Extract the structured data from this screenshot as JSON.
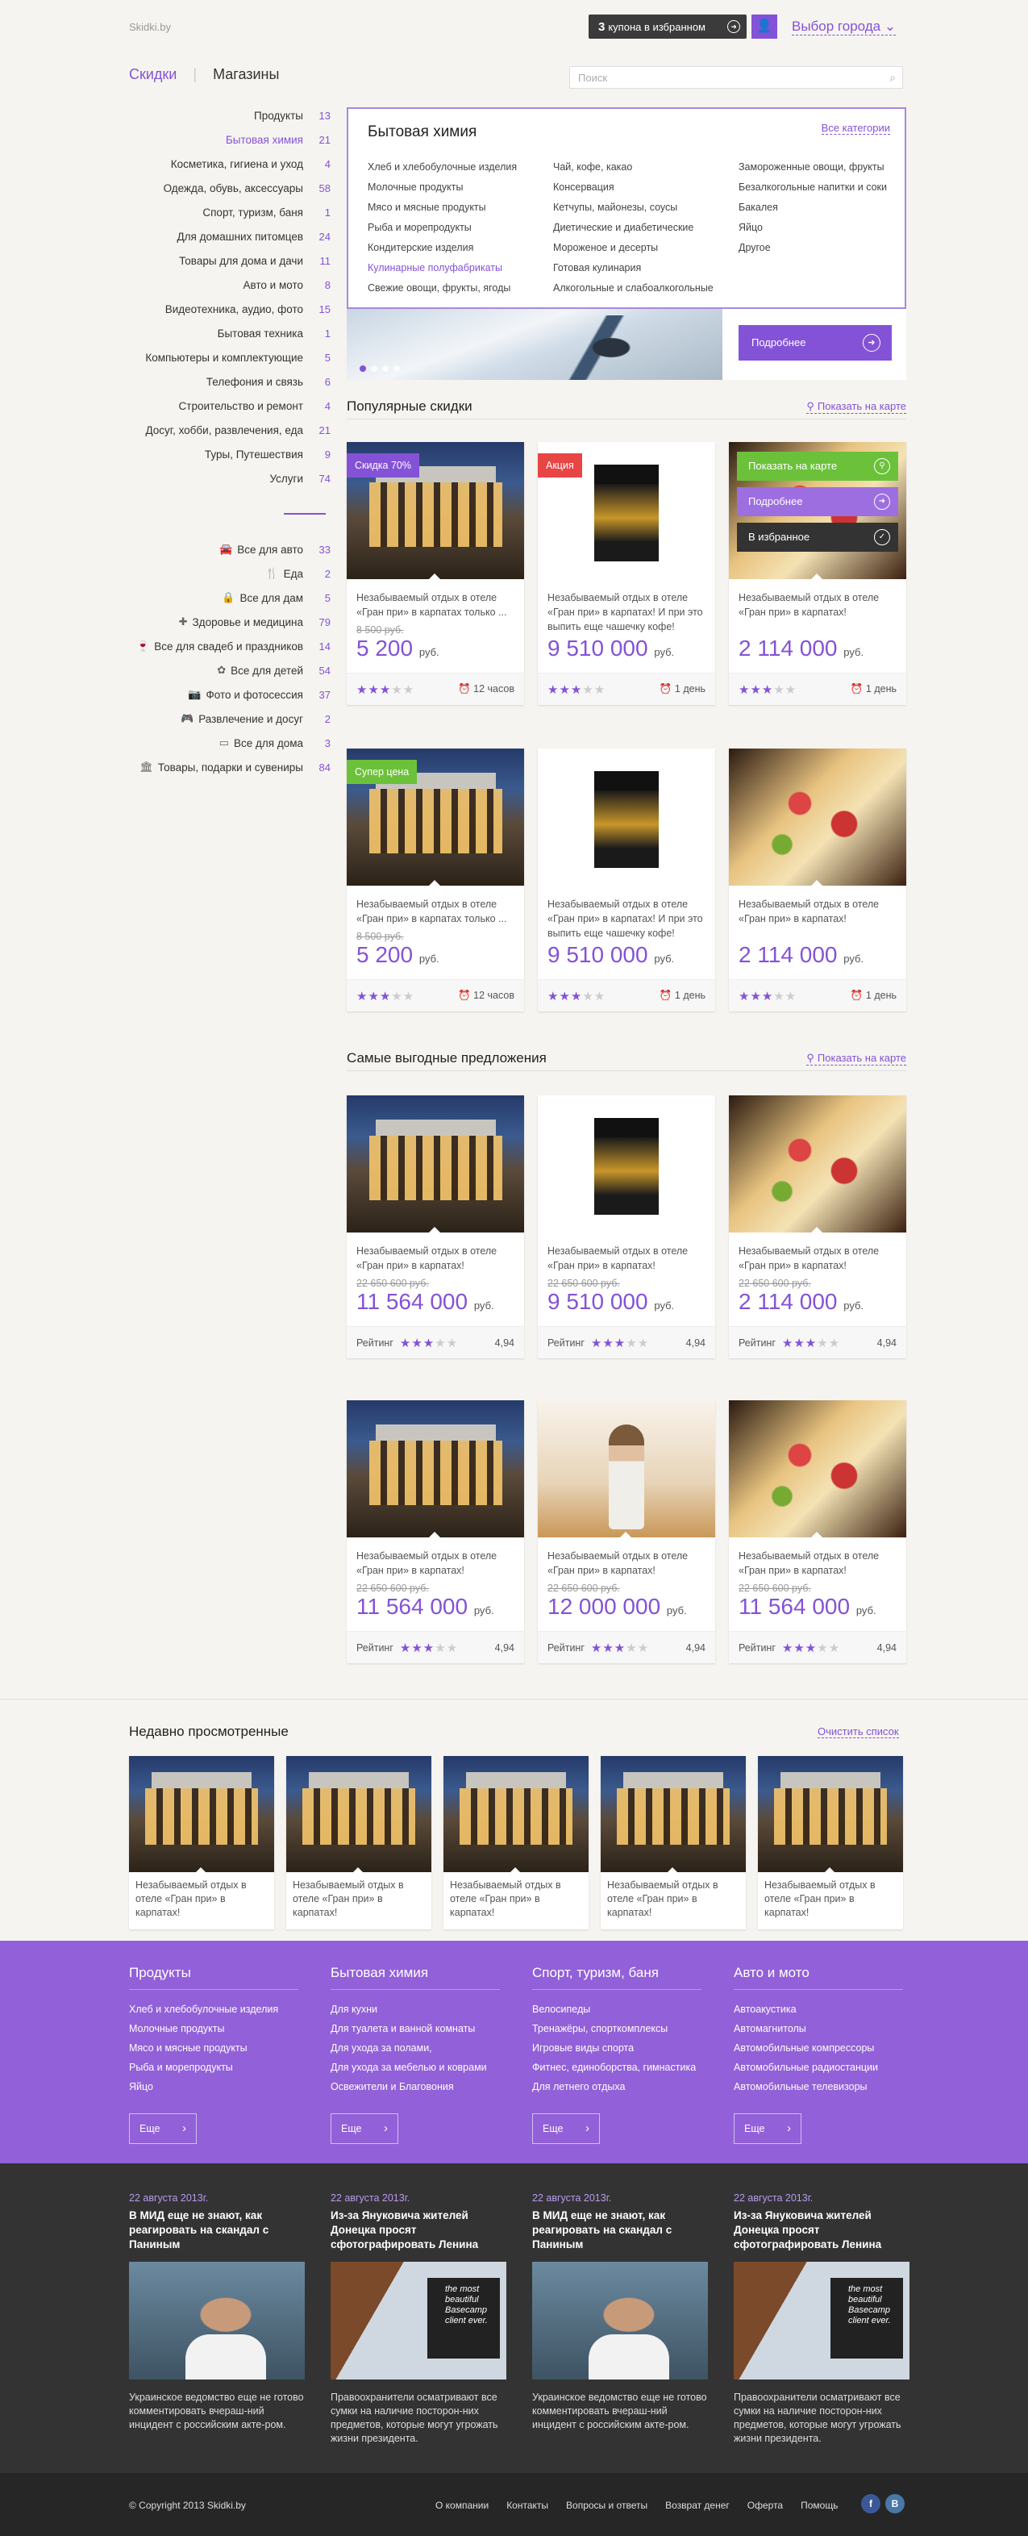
{
  "header": {
    "logo": "Skidki.by",
    "coupons_count": "3",
    "coupons_text": "купона в избранном",
    "city": "Выбор города"
  },
  "tabs": [
    "Скидки",
    "Магазины"
  ],
  "search": {
    "placeholder": "Поиск"
  },
  "sidebar": {
    "main": [
      {
        "label": "Продукты",
        "count": "13"
      },
      {
        "label": "Бытовая химия",
        "count": "21"
      },
      {
        "label": "Косметика, гигиена и уход",
        "count": "4"
      },
      {
        "label": "Одежда, обувь, аксессуары",
        "count": "58"
      },
      {
        "label": "Спорт, туризм, баня",
        "count": "1"
      },
      {
        "label": "Для домашних питомцев",
        "count": "24"
      },
      {
        "label": "Товары для дома и дачи",
        "count": "11"
      },
      {
        "label": "Авто и мото",
        "count": "8"
      },
      {
        "label": "Видеотехника, аудио, фото",
        "count": "15"
      },
      {
        "label": "Бытовая техника",
        "count": "1"
      },
      {
        "label": "Компьютеры и комплектующие",
        "count": "5"
      },
      {
        "label": "Телефония и связь",
        "count": "6"
      },
      {
        "label": "Строительство и ремонт",
        "count": "4"
      },
      {
        "label": "Досуг, хобби, развлечения, еда",
        "count": "21"
      },
      {
        "label": "Туры, Путешествия",
        "count": "9"
      },
      {
        "label": "Услуги",
        "count": "74"
      }
    ],
    "extra": [
      {
        "label": "Все для авто",
        "count": "33",
        "icon": "car-icon"
      },
      {
        "label": "Еда",
        "count": "2",
        "icon": "food-icon"
      },
      {
        "label": "Все для дам",
        "count": "5",
        "icon": "bag-icon"
      },
      {
        "label": "Здоровье и медицина",
        "count": "79",
        "icon": "medicine-icon"
      },
      {
        "label": "Все для свадеб и праздников",
        "count": "14",
        "icon": "glass-icon"
      },
      {
        "label": "Все для детей",
        "count": "54",
        "icon": "toy-icon"
      },
      {
        "label": "Фото и фотосессия",
        "count": "37",
        "icon": "camera-icon"
      },
      {
        "label": "Развлечение и досуг",
        "count": "2",
        "icon": "gamepad-icon"
      },
      {
        "label": "Все для дома",
        "count": "3",
        "icon": "sofa-icon"
      },
      {
        "label": "Товары, подарки и сувениры",
        "count": "84",
        "icon": "gift-icon"
      }
    ]
  },
  "panel": {
    "title": "Бытовая химия",
    "all": "Все категории",
    "col1": [
      "Хлеб и хлебобулочные изделия",
      "Молочные продукты",
      "Мясо и мясные продукты",
      "Рыба и морепродукты",
      "Кондитерские изделия",
      "Кулинарные полуфабрикаты",
      "Свежие овощи, фрукты, ягоды"
    ],
    "col2": [
      "Чай, кофе, какао",
      "Консервация",
      "Кетчупы, майонезы, соусы",
      "Диетические и диабетические",
      "Мороженое и десерты",
      "Готовая кулинария",
      "Алкогольные и слабоалкогольные"
    ],
    "col3": [
      "Замороженные овощи, фрукты",
      "Безалкогольные напитки и соки",
      "Бакалея",
      "Яйцо",
      "Другое"
    ]
  },
  "banner": {
    "button": "Подробнее"
  },
  "popular": {
    "title": "Популярные скидки",
    "map": "Показать на карте",
    "cards": [
      {
        "tag": "Скидка 70%",
        "desc": "Незабываемый отдых в отеле «Гран при» в карпатах только ...",
        "old": "8 500 руб.",
        "price": "5 200",
        "cur": "руб.",
        "time": "12 часов"
      },
      {
        "tag": "Акция",
        "desc": "Незабываемый отдых в отеле «Гран при» в карпатах! И при это выпить еще чашечку кофе!",
        "old": "",
        "price": "9 510 000",
        "cur": "руб.",
        "time": "1 день"
      },
      {
        "tag": "",
        "desc": "Незабываемый отдых в отеле «Гран при» в карпатах!",
        "old": "",
        "price": "2 114 000",
        "cur": "руб.",
        "time": "1 день",
        "hover": [
          "Показать на карте",
          "Подробнее",
          "В избранное"
        ]
      },
      {
        "tag": "Супер цена",
        "desc": "Незабываемый отдых в отеле «Гран при» в карпатах только ...",
        "old": "8 500 руб.",
        "price": "5 200",
        "cur": "руб.",
        "time": "12 часов"
      },
      {
        "tag": "",
        "desc": "Незабываемый отдых в отеле «Гран при» в карпатах! И при это выпить еще чашечку кофе!",
        "old": "",
        "price": "9 510 000",
        "cur": "руб.",
        "time": "1 день"
      },
      {
        "tag": "",
        "desc": "Незабываемый отдых в отеле «Гран при» в карпатах!",
        "old": "",
        "price": "2 114 000",
        "cur": "руб.",
        "time": "1 день"
      }
    ]
  },
  "best": {
    "title": "Самые выгодные предложения",
    "map": "Показать на карте",
    "rating_label": "Рейтинг",
    "cards": [
      {
        "desc": "Незабываемый отдых в отеле «Гран при» в карпатах!",
        "old": "22 650 600 руб.",
        "price": "11 564 000",
        "cur": "руб.",
        "rating": "4,94"
      },
      {
        "desc": "Незабываемый отдых в отеле «Гран при» в карпатах!",
        "old": "22 650 600 руб.",
        "price": "9 510 000",
        "cur": "руб.",
        "rating": "4,94"
      },
      {
        "desc": "Незабываемый отдых в отеле «Гран при» в карпатах!",
        "old": "22 650 600 руб.",
        "price": "2 114 000",
        "cur": "руб.",
        "rating": "4,94"
      },
      {
        "desc": "Незабываемый отдых в отеле «Гран при» в карпатах!",
        "old": "22 650 600 руб.",
        "price": "11 564 000",
        "cur": "руб.",
        "rating": "4,94"
      },
      {
        "desc": "Незабываемый отдых в отеле «Гран при» в карпатах!",
        "old": "22 650 600 руб.",
        "price": "12 000 000",
        "cur": "руб.",
        "rating": "4,94"
      },
      {
        "desc": "Незабываемый отдых в отеле «Гран при» в карпатах!",
        "old": "22 650 600 руб.",
        "price": "11 564 000",
        "cur": "руб.",
        "rating": "4,94"
      }
    ]
  },
  "recent": {
    "title": "Недавно просмотренные",
    "clear": "Очистить список",
    "item": "Незабываемый отдых в отеле «Гран при» в карпатах!"
  },
  "footer_cats": [
    {
      "title": "Продукты",
      "items": [
        "Хлеб и хлебобулочные изделия",
        "Молочные продукты",
        "Мясо и мясные продукты",
        "Рыба и морепродукты",
        "Яйцо"
      ],
      "more": "Еще"
    },
    {
      "title": "Бытовая химия",
      "items": [
        "Для кухни",
        "Для туалета и ванной комнаты",
        "Для ухода за полами,",
        "Для ухода за мебелью и коврами",
        "Освежители и Благовония"
      ],
      "more": "Еще"
    },
    {
      "title": "Спорт, туризм, баня",
      "items": [
        "Велосипеды",
        "Тренажёры, спорткомплексы",
        "Игровые виды спорта",
        "Фитнес, единоборства, гимнастика",
        "Для летнего отдыха"
      ],
      "more": "Еще"
    },
    {
      "title": "Авто и мото",
      "items": [
        "Автоакустика",
        "Автомагнитолы",
        "Автомобильные компрессоры",
        "Автомобильные радиостанции",
        "Автомобильные телевизоры"
      ],
      "more": "Еще"
    }
  ],
  "news": [
    {
      "date": "22 августа 2013г.",
      "title": "В МИД еще не знают, как реагировать на скандал с Паниным",
      "text": "Украинское ведомство еще не готово комментировать вчераш-ний инцидент с российским акте-ром."
    },
    {
      "date": "22 августа 2013г.",
      "title": "Из-за Януковича жителей Донецка просят сфотографировать Ленина",
      "text": "Правоохранители осматривают все сумки на наличие посторон-них предметов, которые могут угрожать жизни президента.",
      "overlay": "the most beautiful Basecamp client ever."
    },
    {
      "date": "22 августа 2013г.",
      "title": "В МИД еще не знают, как реагировать на скандал с Паниным",
      "text": "Украинское ведомство еще не готово комментировать вчераш-ний инцидент с российским акте-ром."
    },
    {
      "date": "22 августа 2013г.",
      "title": "Из-за Януковича жителей Донецка просят сфотографировать Ленина",
      "text": "Правоохранители осматривают все сумки на наличие посторон-них предметов, которые могут угрожать жизни президента.",
      "overlay": "the most beautiful Basecamp client ever."
    }
  ],
  "bottom": {
    "copyright": "© Copyright 2013 Skidki.by",
    "links": [
      "О компании",
      "Контакты",
      "Вопросы и ответы",
      "Возврат денег",
      "Оферта",
      "Помощь"
    ],
    "social": [
      "f",
      "В"
    ]
  },
  "colors": {
    "accent": "#8452d6",
    "footer": "#9260d8",
    "dark": "#333333",
    "tag_red": "#e84545",
    "tag_green": "#6cc13a"
  }
}
